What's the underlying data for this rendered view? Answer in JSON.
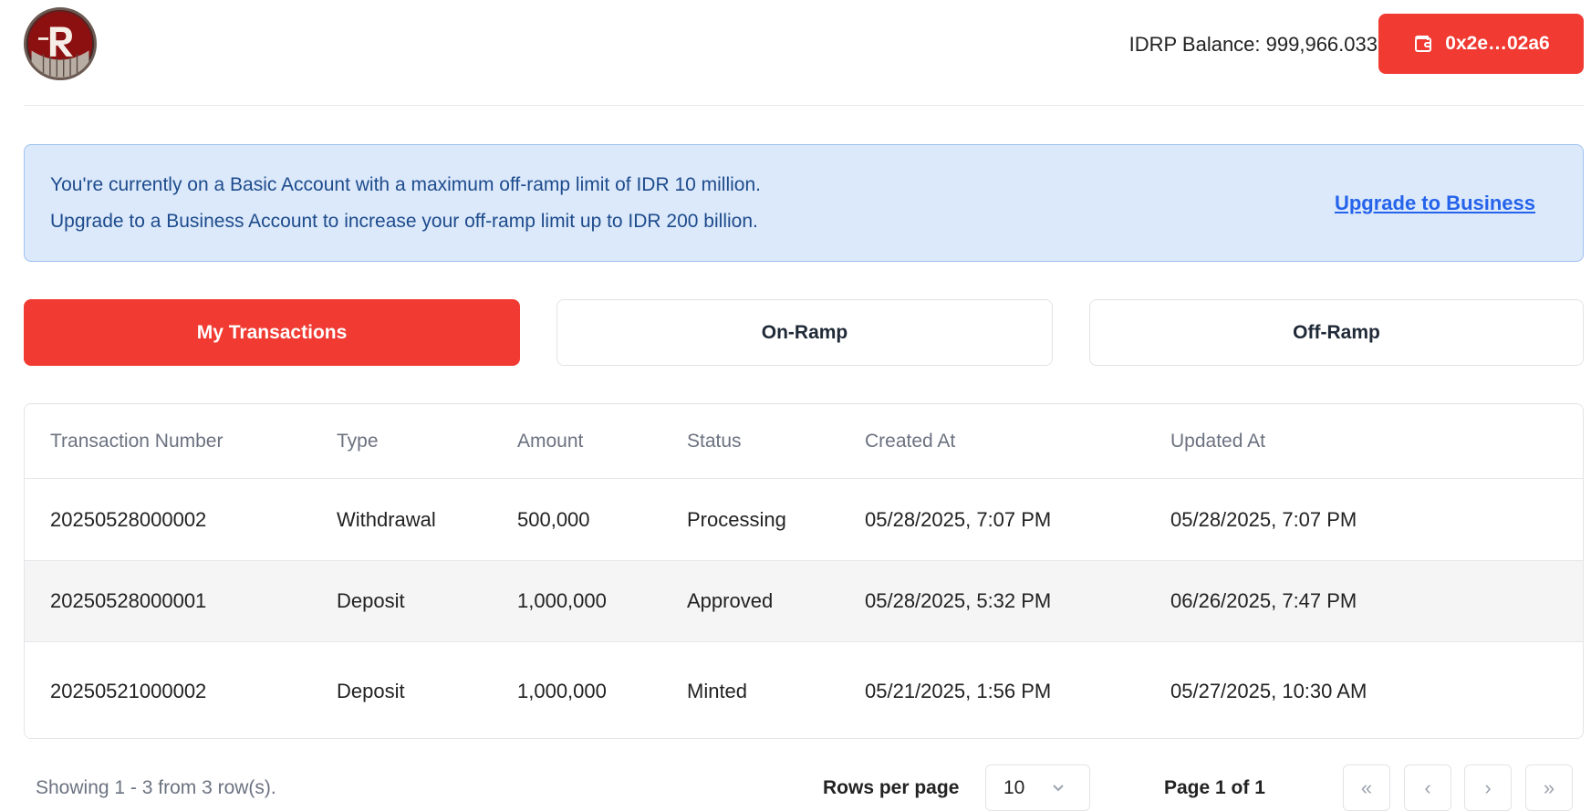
{
  "header": {
    "balance_text": "IDRP Balance: 999,966.033",
    "wallet_address": "0x2e…02a6",
    "accent_color": "#f03a32"
  },
  "banner": {
    "line1": "You're currently on a Basic Account with a maximum off-ramp limit of IDR 10 million.",
    "line2": "Upgrade to a Business Account to increase your off-ramp limit up to IDR 200 billion.",
    "link": "Upgrade to Business"
  },
  "tabs": [
    {
      "label": "My Transactions",
      "active": true
    },
    {
      "label": "On-Ramp",
      "active": false
    },
    {
      "label": "Off-Ramp",
      "active": false
    }
  ],
  "table": {
    "columns": [
      "Transaction Number",
      "Type",
      "Amount",
      "Status",
      "Created At",
      "Updated At"
    ],
    "rows": [
      [
        "20250528000002",
        "Withdrawal",
        "500,000",
        "Processing",
        "05/28/2025, 7:07 PM",
        "05/28/2025, 7:07 PM"
      ],
      [
        "20250528000001",
        "Deposit",
        "1,000,000",
        "Approved",
        "05/28/2025, 5:32 PM",
        "06/26/2025, 7:47 PM"
      ],
      [
        "20250521000002",
        "Deposit",
        "1,000,000",
        "Minted",
        "05/21/2025, 1:56 PM",
        "05/27/2025, 10:30 AM"
      ]
    ]
  },
  "footer": {
    "showing": "Showing 1 - 3 from 3 row(s).",
    "rows_per_page_label": "Rows per page",
    "rows_per_page_value": "10",
    "page_label": "Page 1 of 1",
    "first": "«",
    "prev": "‹",
    "next": "›",
    "last": "»"
  }
}
